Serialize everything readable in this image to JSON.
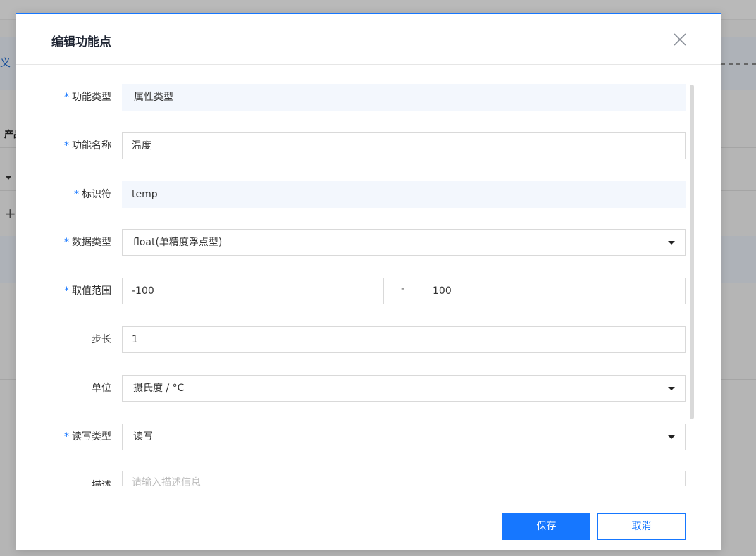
{
  "background": {
    "link_text": "义",
    "label_text": "产品",
    "plus_glyph": "+"
  },
  "dialog": {
    "title": "编辑功能点",
    "close_glyph": "×"
  },
  "form": {
    "required_mark": "*",
    "function_type": {
      "label": "功能类型",
      "value": "属性类型"
    },
    "function_name": {
      "label": "功能名称",
      "value": "温度"
    },
    "identifier": {
      "label": "标识符",
      "value": "temp"
    },
    "data_type": {
      "label": "数据类型",
      "value": "float(单精度浮点型)"
    },
    "value_range": {
      "label": "取值范围",
      "min": "-100",
      "separator": "-",
      "max": "100"
    },
    "step": {
      "label": "步长",
      "value": "1"
    },
    "unit": {
      "label": "单位",
      "value": "摄氏度 / °C"
    },
    "rw_type": {
      "label": "读写类型",
      "value": "读写"
    },
    "description": {
      "label": "描述",
      "placeholder": "请输入描述信息"
    }
  },
  "footer": {
    "save_label": "保存",
    "cancel_label": "取消"
  },
  "colors": {
    "accent": "#1677ff",
    "readonly_bg": "#f3f7fd"
  }
}
